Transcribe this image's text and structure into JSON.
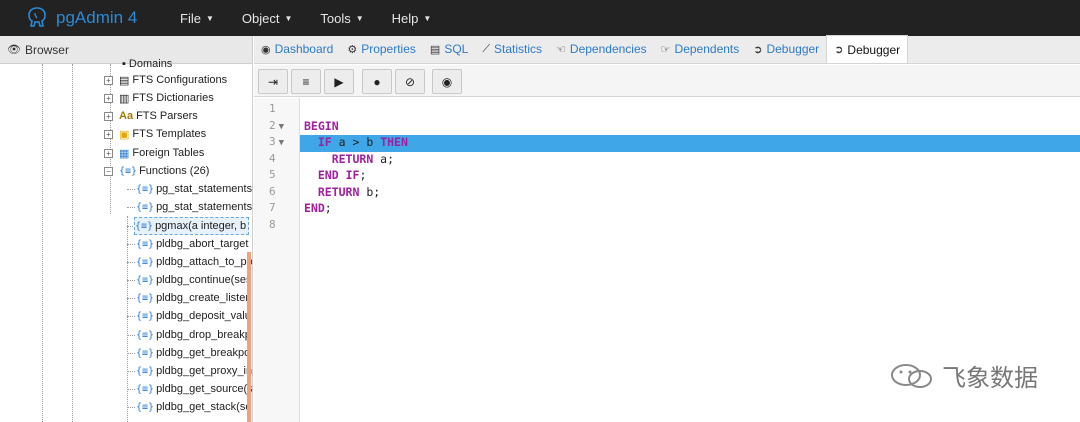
{
  "app": {
    "name": "pgAdmin 4"
  },
  "menu": [
    {
      "label": "File"
    },
    {
      "label": "Object"
    },
    {
      "label": "Tools"
    },
    {
      "label": "Help"
    }
  ],
  "browser": {
    "title": "Browser",
    "tree": {
      "cut_top_label": "Domains",
      "groups": [
        {
          "label": "FTS Configurations"
        },
        {
          "label": "FTS Dictionaries"
        },
        {
          "label": "FTS Parsers"
        },
        {
          "label": "FTS Templates"
        },
        {
          "label": "Foreign Tables"
        },
        {
          "label": "Functions (26)"
        }
      ],
      "functions": [
        {
          "label": "pg_stat_statements"
        },
        {
          "label": "pg_stat_statements"
        },
        {
          "label": "pgmax(a integer, b"
        },
        {
          "label": "pldbg_abort_target"
        },
        {
          "label": "pldbg_attach_to_po"
        },
        {
          "label": "pldbg_continue(ses"
        },
        {
          "label": "pldbg_create_listen"
        },
        {
          "label": "pldbg_deposit_valu"
        },
        {
          "label": "pldbg_drop_breakp"
        },
        {
          "label": "pldbg_get_breakpo"
        },
        {
          "label": "pldbg_get_proxy_in"
        },
        {
          "label": "pldbg_get_source(s"
        },
        {
          "label": "pldbg_get_stack(se"
        }
      ]
    }
  },
  "tabs": [
    {
      "label": "Dashboard",
      "icon": "tachometer-icon"
    },
    {
      "label": "Properties",
      "icon": "cogs-icon"
    },
    {
      "label": "SQL",
      "icon": "file-text-icon"
    },
    {
      "label": "Statistics",
      "icon": "line-chart-icon"
    },
    {
      "label": "Dependencies",
      "icon": "hand-icon"
    },
    {
      "label": "Dependents",
      "icon": "hand-icon"
    },
    {
      "label": "Debugger",
      "icon": "arrow-circle-icon"
    },
    {
      "label": "Debugger",
      "icon": "arrow-circle-icon",
      "active": true
    }
  ],
  "toolbar": {
    "buttons": [
      {
        "name": "step-into",
        "icon": "step-into-icon"
      },
      {
        "name": "step-over",
        "icon": "step-over-icon"
      },
      {
        "name": "continue",
        "icon": "play-circle-icon"
      },
      {
        "name": "toggle-breakpoint",
        "icon": "circle-icon"
      },
      {
        "name": "clear-breakpoints",
        "icon": "ban-icon"
      },
      {
        "name": "stop",
        "icon": "stop-circle-icon"
      }
    ]
  },
  "editor": {
    "lines": [
      {
        "num": "1",
        "fold": "",
        "text": ""
      },
      {
        "num": "2",
        "fold": "▼",
        "text": "BEGIN"
      },
      {
        "num": "3",
        "fold": "▼",
        "text": "  IF a > b THEN",
        "highlight": true
      },
      {
        "num": "4",
        "fold": "",
        "text": "    RETURN a;"
      },
      {
        "num": "5",
        "fold": "",
        "text": "  END IF;"
      },
      {
        "num": "6",
        "fold": "",
        "text": "  RETURN b;"
      },
      {
        "num": "7",
        "fold": "",
        "text": "END;"
      },
      {
        "num": "8",
        "fold": "",
        "text": ""
      }
    ],
    "highlight_color": "#3fa6e8",
    "keyword_color": "#a01f9e"
  },
  "watermark": {
    "text": "飞象数据"
  }
}
